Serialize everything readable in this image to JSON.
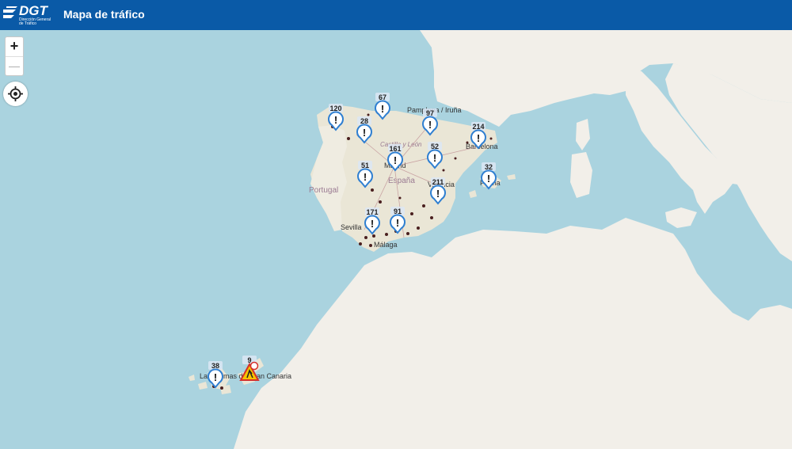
{
  "header": {
    "logo_text": "DGT",
    "logo_sub": "Dirección General de Tráfico",
    "title": "Mapa de tráfico"
  },
  "controls": {
    "zoom_in": "+",
    "zoom_out": "—"
  },
  "map_labels": {
    "portugal": "Portugal",
    "espana": "España",
    "sevilla": "Sevilla",
    "malaga": "Málaga",
    "madrid": "Madrid",
    "pamplona": "Pamplona / Iruña",
    "barcelona": "Barcelona",
    "valencia": "València",
    "palma": "Palma",
    "castilla": "Castilla y León",
    "las_palmas": "Las Palmas de Gran Canaria"
  },
  "clusters": [
    {
      "count": "120"
    },
    {
      "count": "67"
    },
    {
      "count": "28"
    },
    {
      "count": "97"
    },
    {
      "count": "214"
    },
    {
      "count": "161"
    },
    {
      "count": "52"
    },
    {
      "count": "51"
    },
    {
      "count": "32"
    },
    {
      "count": "211"
    },
    {
      "count": "171"
    },
    {
      "count": "91"
    },
    {
      "count": "38"
    },
    {
      "count": "9"
    }
  ],
  "colors": {
    "sea": "#aad3df",
    "land": "#f2efe9",
    "spain_land": "#eae6d6",
    "header": "#0a5aa7",
    "pin_blue": "#2f7fd1"
  }
}
